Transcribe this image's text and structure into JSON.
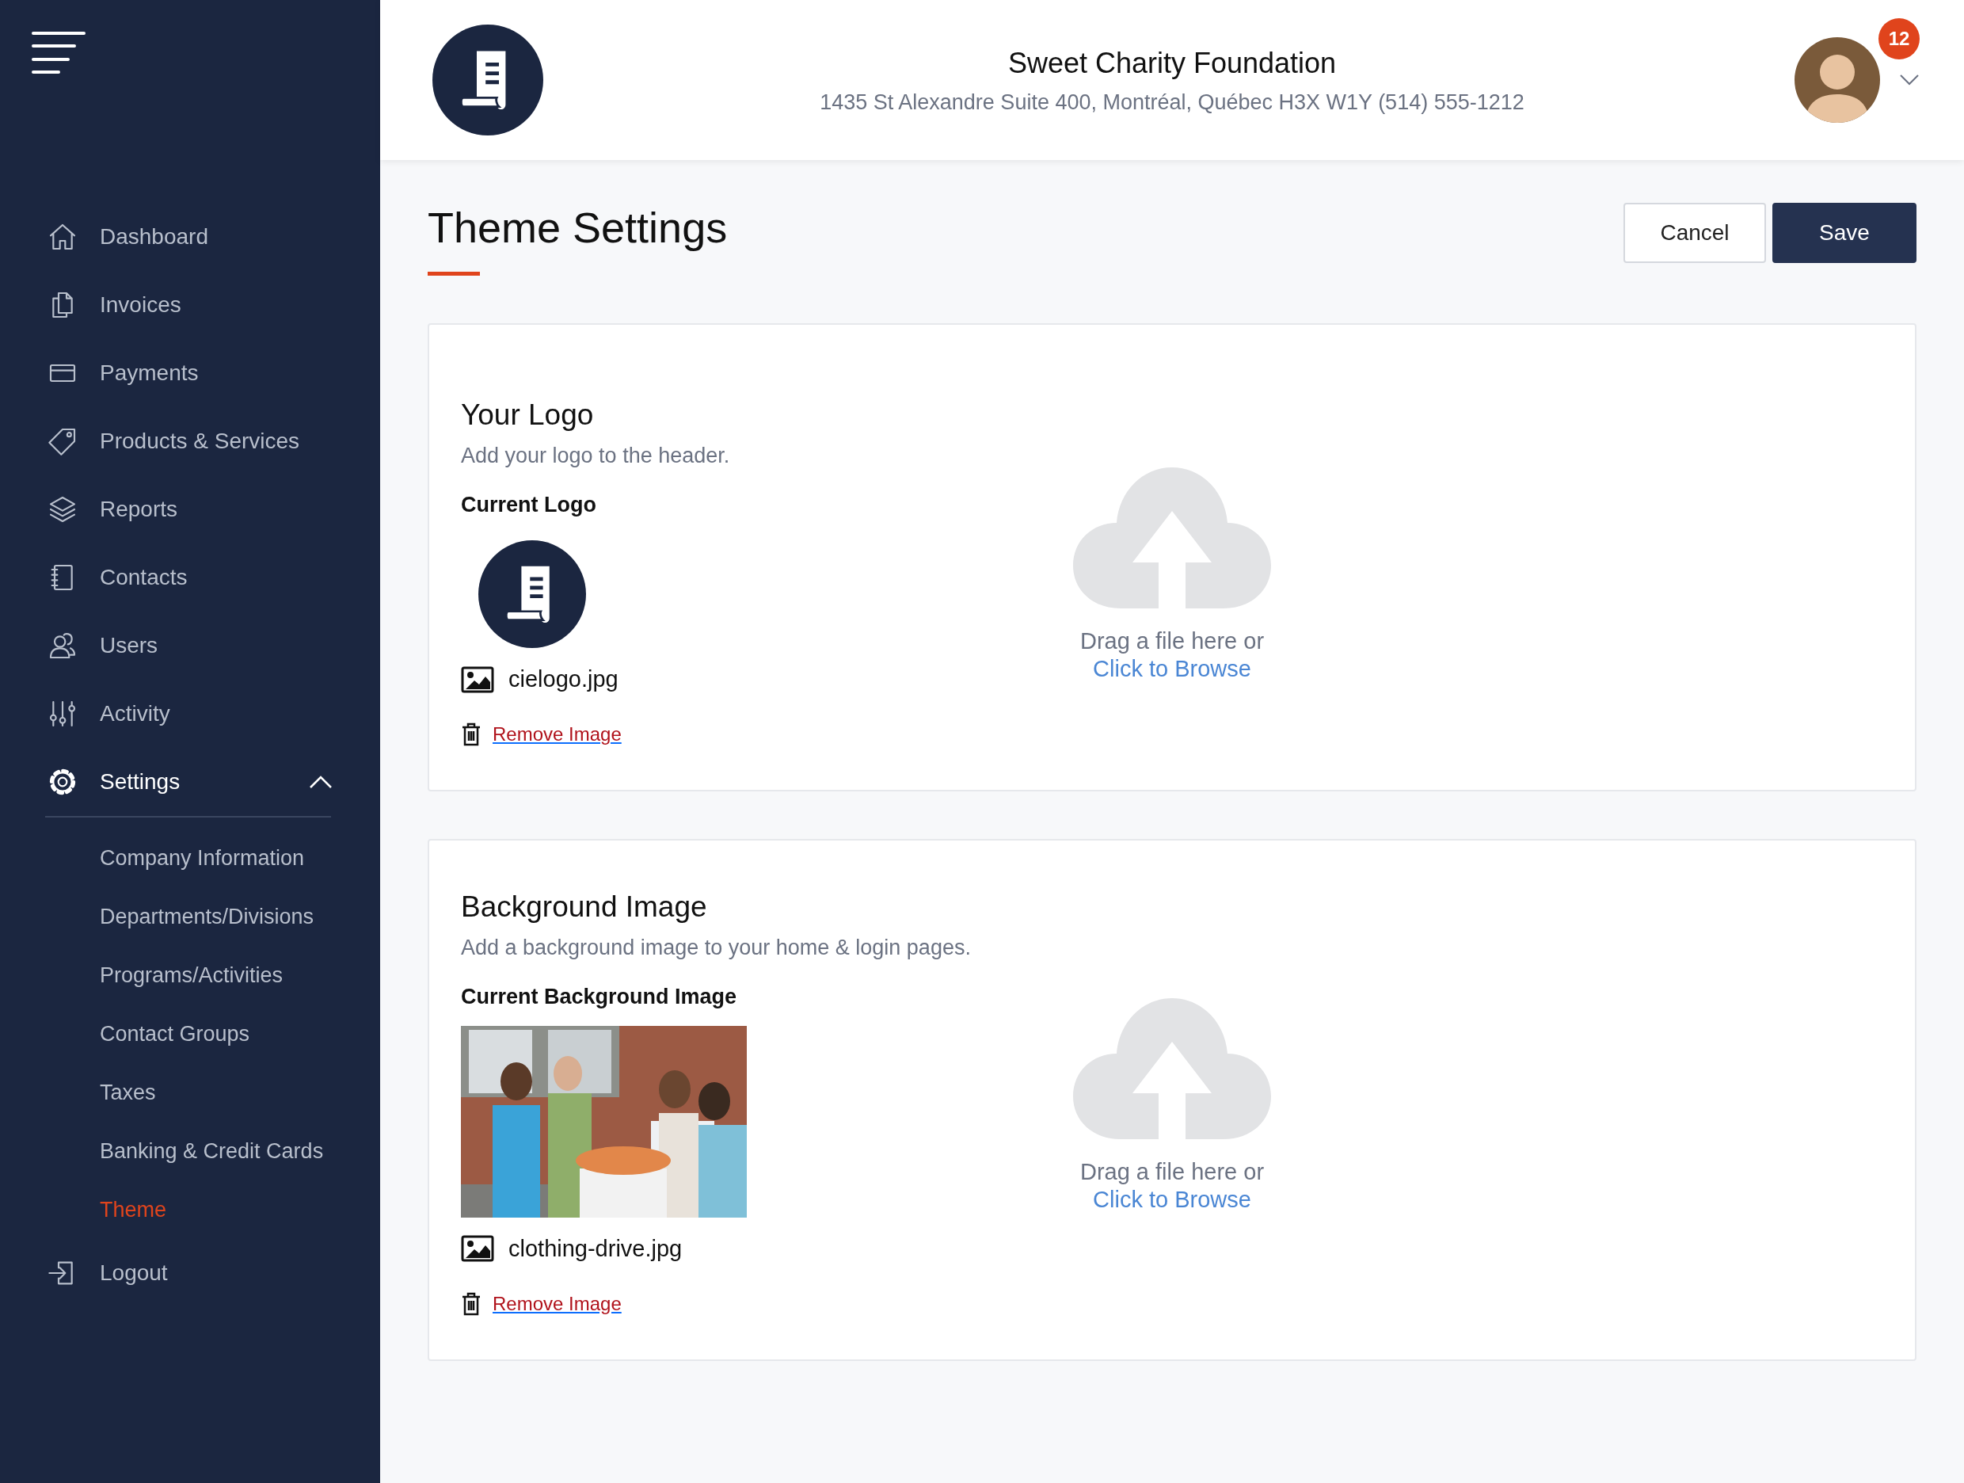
{
  "sidebar": {
    "items": [
      {
        "label": "Dashboard",
        "selected": false
      },
      {
        "label": "Invoices",
        "selected": false
      },
      {
        "label": "Payments",
        "selected": false
      },
      {
        "label": "Products & Services",
        "selected": false
      },
      {
        "label": "Reports",
        "selected": false
      },
      {
        "label": "Contacts",
        "selected": false
      },
      {
        "label": "Users",
        "selected": false
      },
      {
        "label": "Activity",
        "selected": false
      },
      {
        "label": "Settings",
        "selected": true,
        "expanded": true,
        "children": [
          {
            "label": "Company Information",
            "selected": false
          },
          {
            "label": "Departments/Divisions",
            "selected": false
          },
          {
            "label": "Programs/Activities",
            "selected": false
          },
          {
            "label": "Contact Groups",
            "selected": false
          },
          {
            "label": "Taxes",
            "selected": false
          },
          {
            "label": "Banking & Credit Cards",
            "selected": false
          },
          {
            "label": "Theme",
            "selected": true
          }
        ]
      },
      {
        "label": "Logout",
        "selected": false
      }
    ]
  },
  "header": {
    "organization": "Sweet Charity Foundation",
    "address": "1435 St Alexandre Suite 400, Montréal, Québec H3X W1Y (514) 555-1212",
    "notification_count": "12"
  },
  "page": {
    "title": "Theme Settings",
    "buttons": [
      {
        "label": "Cancel",
        "kind": "secondary"
      },
      {
        "label": "Save",
        "kind": "primary"
      }
    ]
  },
  "sections": [
    {
      "title": "Your Logo",
      "description": "Add your logo to the header.",
      "current_label": "Current Logo",
      "preview": {
        "kind": "logo"
      },
      "file_name": "cielogo.jpg",
      "remove_label": "Remove Image",
      "upload": {
        "prompt": "Drag a file here or",
        "link": "Click to Browse"
      }
    },
    {
      "title": "Background Image",
      "description": "Add a background image to your home & login pages.",
      "current_label": "Current Background Image",
      "file_name": "clothing-drive.jpg",
      "remove_label": "Remove Image",
      "upload": {
        "prompt": "Drag a file here or",
        "link": "Click to Browse"
      }
    }
  ]
}
